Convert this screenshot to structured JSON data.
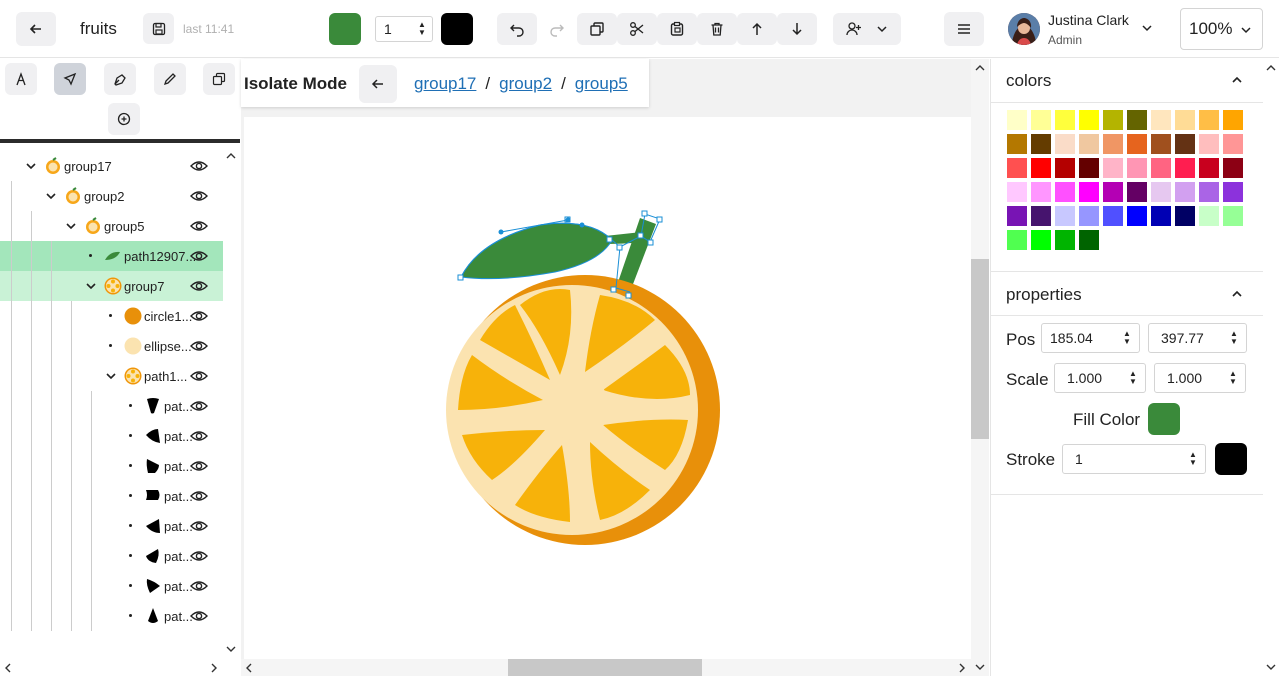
{
  "header": {
    "title": "fruits",
    "last_saved": "last 11:41",
    "fill_color": "#3a8a3a",
    "stroke_color": "#000000",
    "stroke_width": "1",
    "user_name": "Justina Clark",
    "user_role": "Admin",
    "zoom": "100%"
  },
  "isolate": {
    "label": "Isolate Mode",
    "crumbs": [
      "group17",
      "group2",
      "group5"
    ],
    "separator": "/"
  },
  "layers": [
    {
      "label": "group17",
      "icon": "orange-icon"
    },
    {
      "label": "group2",
      "icon": "orange-icon"
    },
    {
      "label": "group5",
      "icon": "orange-icon"
    },
    {
      "label": "path12907...",
      "icon": "leaf-icon"
    },
    {
      "label": "group7",
      "icon": "orange-slice-icon"
    },
    {
      "label": "circle1...",
      "icon": "circle-icon"
    },
    {
      "label": "ellipse...",
      "icon": "ellipse-icon"
    },
    {
      "label": "path1...",
      "icon": "orange-slice-icon"
    },
    {
      "label": "pat...",
      "icon": "segment-icon"
    },
    {
      "label": "pat...",
      "icon": "segment-icon"
    },
    {
      "label": "pat...",
      "icon": "segment-icon"
    },
    {
      "label": "pat...",
      "icon": "segment-icon"
    },
    {
      "label": "pat...",
      "icon": "segment-icon"
    },
    {
      "label": "pat...",
      "icon": "segment-icon"
    },
    {
      "label": "pat...",
      "icon": "segment-icon"
    },
    {
      "label": "pat...",
      "icon": "segment-icon"
    }
  ],
  "colors_panel": {
    "title": "colors",
    "palette": [
      "#ffffc8",
      "#ffff96",
      "#ffff3c",
      "#ffff00",
      "#b4b400",
      "#646400",
      "#ffe6be",
      "#ffdc96",
      "#ffbe46",
      "#ffa500",
      "#b47800",
      "#643c00",
      "#fadcc8",
      "#f0c8a0",
      "#f09664",
      "#e6641e",
      "#a0501e",
      "#643214",
      "#ffbebe",
      "#ff9696",
      "#ff5050",
      "#ff0000",
      "#b40000",
      "#640000",
      "#ffb4c8",
      "#ff96b4",
      "#ff6482",
      "#ff1e50",
      "#c8001e",
      "#8c0014",
      "#ffc8ff",
      "#ff96ff",
      "#ff50ff",
      "#ff00ff",
      "#b400b4",
      "#640064",
      "#e6c8f0",
      "#d2a0f0",
      "#aa64e6",
      "#8c32dc",
      "#7814b4",
      "#46146e",
      "#c8c8ff",
      "#9696ff",
      "#5050ff",
      "#0000ff",
      "#0000b4",
      "#000064",
      "#c8ffc8",
      "#96ff96",
      "#50ff50",
      "#00ff00",
      "#00b400",
      "#006400"
    ]
  },
  "properties_panel": {
    "title": "properties",
    "pos_label": "Pos",
    "pos_x": "185.04",
    "pos_y": "397.77",
    "scale_label": "Scale",
    "scale_x": "1.000",
    "scale_y": "1.000",
    "fill_label": "Fill Color",
    "fill_color": "#3a8a3a",
    "stroke_label": "Stroke",
    "stroke_value": "1",
    "stroke_color": "#000000"
  },
  "canvas": {
    "leaf_color": "#3a8a3a",
    "peel_color": "#e8900a",
    "pith_color": "#fbe3b0",
    "segment_color": "#f7b20a",
    "selection_color": "#1a8fd6"
  }
}
